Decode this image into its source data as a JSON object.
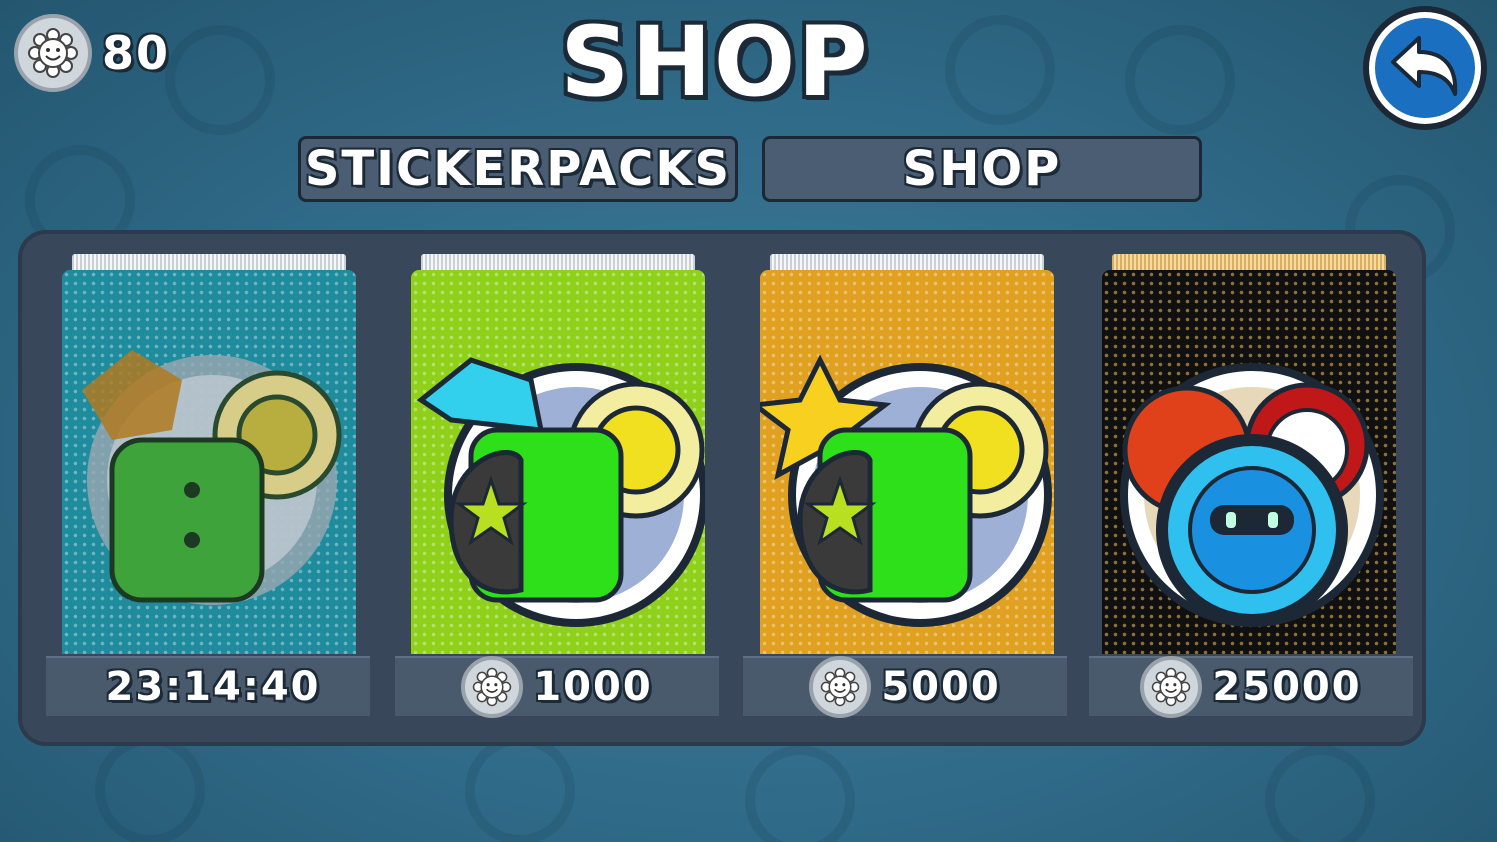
{
  "header": {
    "coins": "80",
    "title": "SHOP",
    "back_icon": "back-arrow-icon"
  },
  "tabs": [
    {
      "label": "STICKERPACKS"
    },
    {
      "label": "SHOP"
    }
  ],
  "packs": [
    {
      "price": "23:14:40",
      "color": "#1f8c9e",
      "state": "locked",
      "shows_coin": false
    },
    {
      "price": "1000",
      "color": "#8fd11a",
      "shows_coin": true
    },
    {
      "price": "5000",
      "color": "#e0a020",
      "shows_coin": true
    },
    {
      "price": "25000",
      "color": "#101010",
      "accent": "#f0c060",
      "shows_coin": true
    }
  ],
  "colors": {
    "panel": "#39475a",
    "tab": "#4a5d72",
    "back_button": "#1a6fc0"
  }
}
